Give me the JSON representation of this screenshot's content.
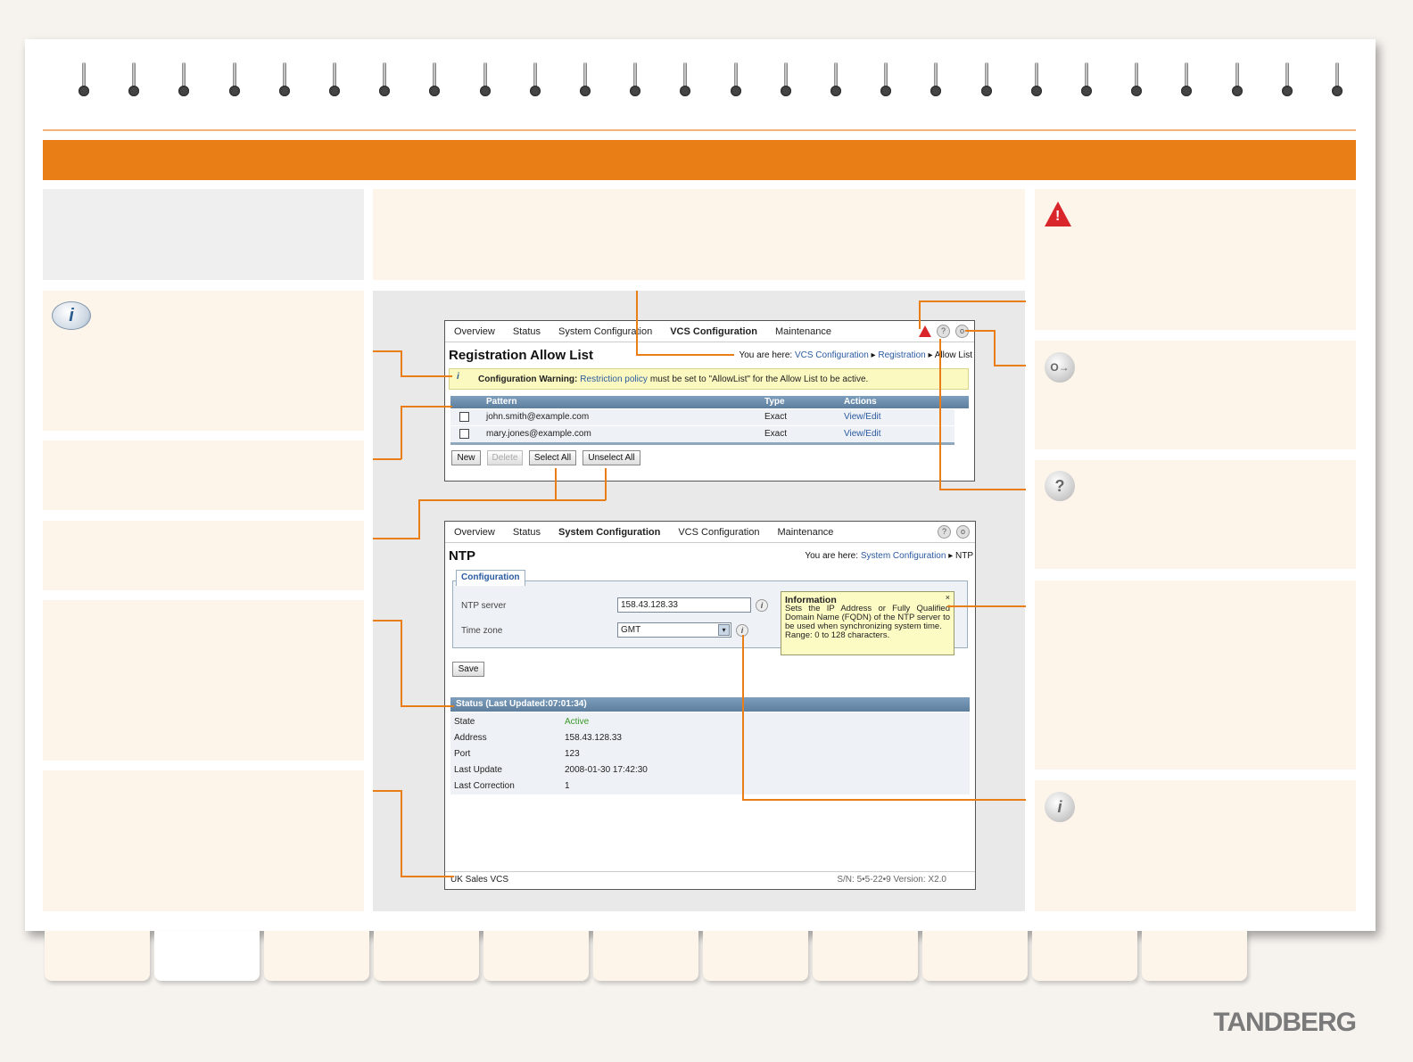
{
  "nav1": {
    "items": [
      "Overview",
      "Status",
      "System Configuration",
      "VCS Configuration",
      "Maintenance"
    ],
    "active": "VCS Configuration"
  },
  "allow_list": {
    "title": "Registration Allow List",
    "crumb_prefix": "You are here:",
    "crumb_1": "VCS Configuration",
    "crumb_2": "Registration",
    "crumb_3": "Allow List",
    "warning_label": "Configuration Warning:",
    "warning_link": "Restriction policy",
    "warning_text": "must be set to \"AllowList\" for the Allow List to be active.",
    "col_pattern": "Pattern",
    "col_type": "Type",
    "col_actions": "Actions",
    "rows": [
      {
        "pattern": "john.smith@example.com",
        "type": "Exact",
        "action": "View/Edit"
      },
      {
        "pattern": "mary.jones@example.com",
        "type": "Exact",
        "action": "View/Edit"
      }
    ],
    "btn_new": "New",
    "btn_delete": "Delete",
    "btn_select_all": "Select All",
    "btn_unselect_all": "Unselect All"
  },
  "nav2": {
    "items": [
      "Overview",
      "Status",
      "System Configuration",
      "VCS Configuration",
      "Maintenance"
    ],
    "active": "System Configuration"
  },
  "ntp": {
    "title": "NTP",
    "crumb_prefix": "You are here:",
    "crumb_1": "System Configuration",
    "crumb_2": "NTP",
    "legend": "Configuration",
    "label_server": "NTP server",
    "value_server": "158.43.128.33",
    "label_tz": "Time zone",
    "value_tz": "GMT",
    "tooltip_title": "Information",
    "tooltip_text": "Sets the IP Address or Fully Qualified Domain Name (FQDN) of the NTP server to be used when synchronizing system time.",
    "tooltip_range": "Range: 0 to 128 characters.",
    "btn_save": "Save",
    "status_title": "Status (Last Updated:07:01:34)",
    "status_rows": [
      {
        "label": "State",
        "value": "Active"
      },
      {
        "label": "Address",
        "value": "158.43.128.33"
      },
      {
        "label": "Port",
        "value": "123"
      },
      {
        "label": "Last Update",
        "value": "2008-01-30 17:42:30"
      },
      {
        "label": "Last Correction",
        "value": "1"
      }
    ],
    "footer_left": "UK Sales VCS",
    "footer_right": "S/N: 5•5-22•9  Version: X2.0"
  },
  "brand": "TANDBERG",
  "colors": {
    "accent": "#e97e16",
    "panel": "#fdf4ea",
    "warning": "#d8262b"
  }
}
